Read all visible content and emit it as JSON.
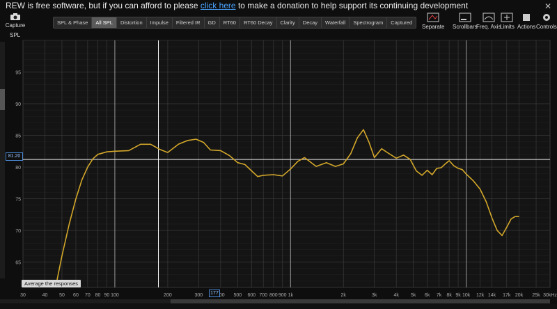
{
  "banner": {
    "prefix": "REW is free software, but if you can afford to please ",
    "link": "click here",
    "suffix": " to make a donation to help support its continuing development"
  },
  "capture_label": "Capture",
  "tabs": [
    "SPL & Phase",
    "All SPL",
    "Distortion",
    "Impulse",
    "Filtered IR",
    "GD",
    "RT60",
    "RT60 Decay",
    "Clarity",
    "Decay",
    "Waterfall",
    "Spectrogram",
    "Captured"
  ],
  "active_tab": "All SPL",
  "toolbar": {
    "separate": "Separate",
    "scrollbars": "Scrollbars",
    "freq_axis": "Freq. Axis",
    "limits": "Limits",
    "actions": "Actions",
    "controls": "Controls"
  },
  "y_axis_title": "SPL",
  "level_readout": "81.20",
  "cursor_readout": "177",
  "average_button": "Average the responses",
  "colors": {
    "trace": "#d4a82a",
    "grid_major": "#3a3a3a",
    "grid_minor": "#222",
    "cursor": "#ffffff"
  },
  "chart_data": {
    "type": "line",
    "xscale": "log",
    "xlim": [
      30,
      30000
    ],
    "ylim": [
      61,
      100
    ],
    "yticks": [
      65,
      70,
      75,
      80,
      85,
      90,
      95
    ],
    "xticks": [
      {
        "v": 30,
        "l": "30"
      },
      {
        "v": 40,
        "l": "40"
      },
      {
        "v": 50,
        "l": "50"
      },
      {
        "v": 60,
        "l": "60"
      },
      {
        "v": 70,
        "l": "70"
      },
      {
        "v": 80,
        "l": "80"
      },
      {
        "v": 90,
        "l": "90"
      },
      {
        "v": 100,
        "l": "100"
      },
      {
        "v": 200,
        "l": "200"
      },
      {
        "v": 300,
        "l": "300"
      },
      {
        "v": 400,
        "l": "400"
      },
      {
        "v": 500,
        "l": "500"
      },
      {
        "v": 600,
        "l": "600"
      },
      {
        "v": 700,
        "l": "700"
      },
      {
        "v": 800,
        "l": "800"
      },
      {
        "v": 900,
        "l": "900"
      },
      {
        "v": 1000,
        "l": "1k"
      },
      {
        "v": 2000,
        "l": "2k"
      },
      {
        "v": 3000,
        "l": "3k"
      },
      {
        "v": 4000,
        "l": "4k"
      },
      {
        "v": 5000,
        "l": "5k"
      },
      {
        "v": 6000,
        "l": "6k"
      },
      {
        "v": 7000,
        "l": "7k"
      },
      {
        "v": 8000,
        "l": "8k"
      },
      {
        "v": 9000,
        "l": "9k"
      },
      {
        "v": 10000,
        "l": "10k"
      },
      {
        "v": 12000,
        "l": "12k"
      },
      {
        "v": 14000,
        "l": "14k"
      },
      {
        "v": 17000,
        "l": "17k"
      },
      {
        "v": 20000,
        "l": "20k"
      },
      {
        "v": 25000,
        "l": "25k"
      },
      {
        "v": 30000,
        "l": "30kHz"
      }
    ],
    "reference_level": 81.2,
    "cursor_freq": 177,
    "series": [
      {
        "x": [
          46,
          50,
          55,
          60,
          65,
          70,
          75,
          80,
          90,
          100,
          120,
          140,
          160,
          180,
          200,
          230,
          260,
          290,
          320,
          350,
          400,
          450,
          500,
          550,
          600,
          650,
          700,
          800,
          900,
          1000,
          1100,
          1200,
          1400,
          1600,
          1800,
          2000,
          2200,
          2400,
          2600,
          2800,
          3000,
          3300,
          3600,
          4000,
          4400,
          4800,
          5200,
          5600,
          6000,
          6400,
          6800,
          7200,
          7600,
          8000,
          8500,
          9000,
          9500,
          10000,
          11000,
          12000,
          13000,
          14000,
          15000,
          16000,
          17000,
          18000,
          19000,
          20000
        ],
        "y": [
          61,
          66,
          71,
          75,
          78,
          80,
          81.3,
          82,
          82.4,
          82.5,
          82.6,
          83.6,
          83.6,
          82.8,
          82.3,
          83.6,
          84.2,
          84.4,
          83.9,
          82.7,
          82.6,
          81.8,
          80.7,
          80.4,
          79.4,
          78.5,
          78.7,
          78.8,
          78.6,
          79.7,
          80.9,
          81.5,
          80.1,
          80.7,
          80.1,
          80.5,
          82.1,
          84.6,
          85.9,
          83.9,
          81.5,
          82.9,
          82.2,
          81.4,
          81.9,
          81.2,
          79.4,
          78.7,
          79.5,
          78.8,
          79.8,
          79.9,
          80.5,
          81.0,
          80.2,
          79.8,
          79.6,
          78.9,
          77.8,
          76.5,
          74.5,
          72.0,
          70.0,
          69.2,
          70.5,
          71.8,
          72.2,
          72.2
        ]
      }
    ]
  }
}
